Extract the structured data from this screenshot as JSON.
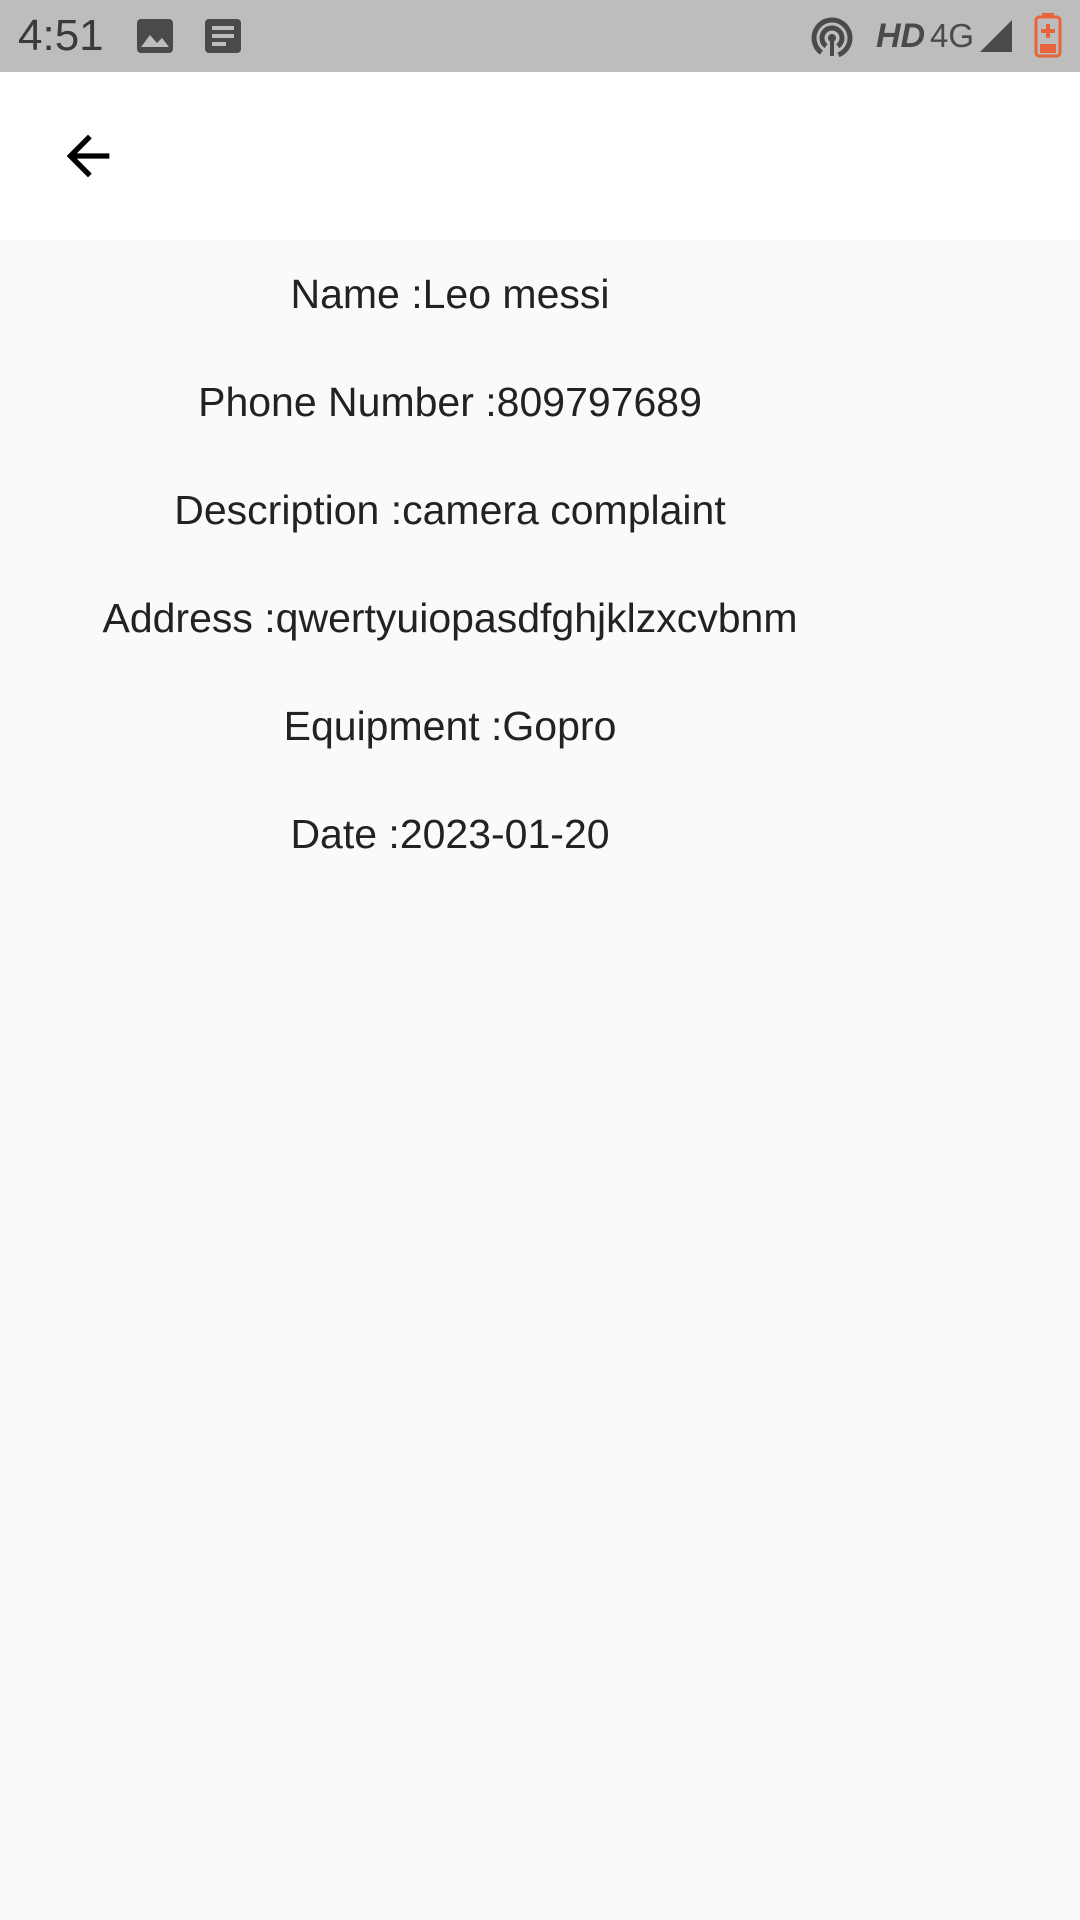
{
  "status_bar": {
    "time": "4:51",
    "hd_label": "HD",
    "network_label": "4G",
    "icons": [
      "image-icon",
      "notes-icon",
      "hotspot-icon",
      "signal-icon",
      "battery-icon"
    ],
    "battery_color": "#e8643c"
  },
  "app_bar": {
    "back_icon": "arrow-left-icon"
  },
  "details": {
    "name": "Name :Leo messi",
    "phone": "Phone Number :809797689",
    "description": "Description :camera complaint",
    "address": "Address :qwertyuiopasdfghjklzxcvbnm",
    "equipment": "Equipment :Gopro",
    "date": "Date :2023-01-20"
  }
}
